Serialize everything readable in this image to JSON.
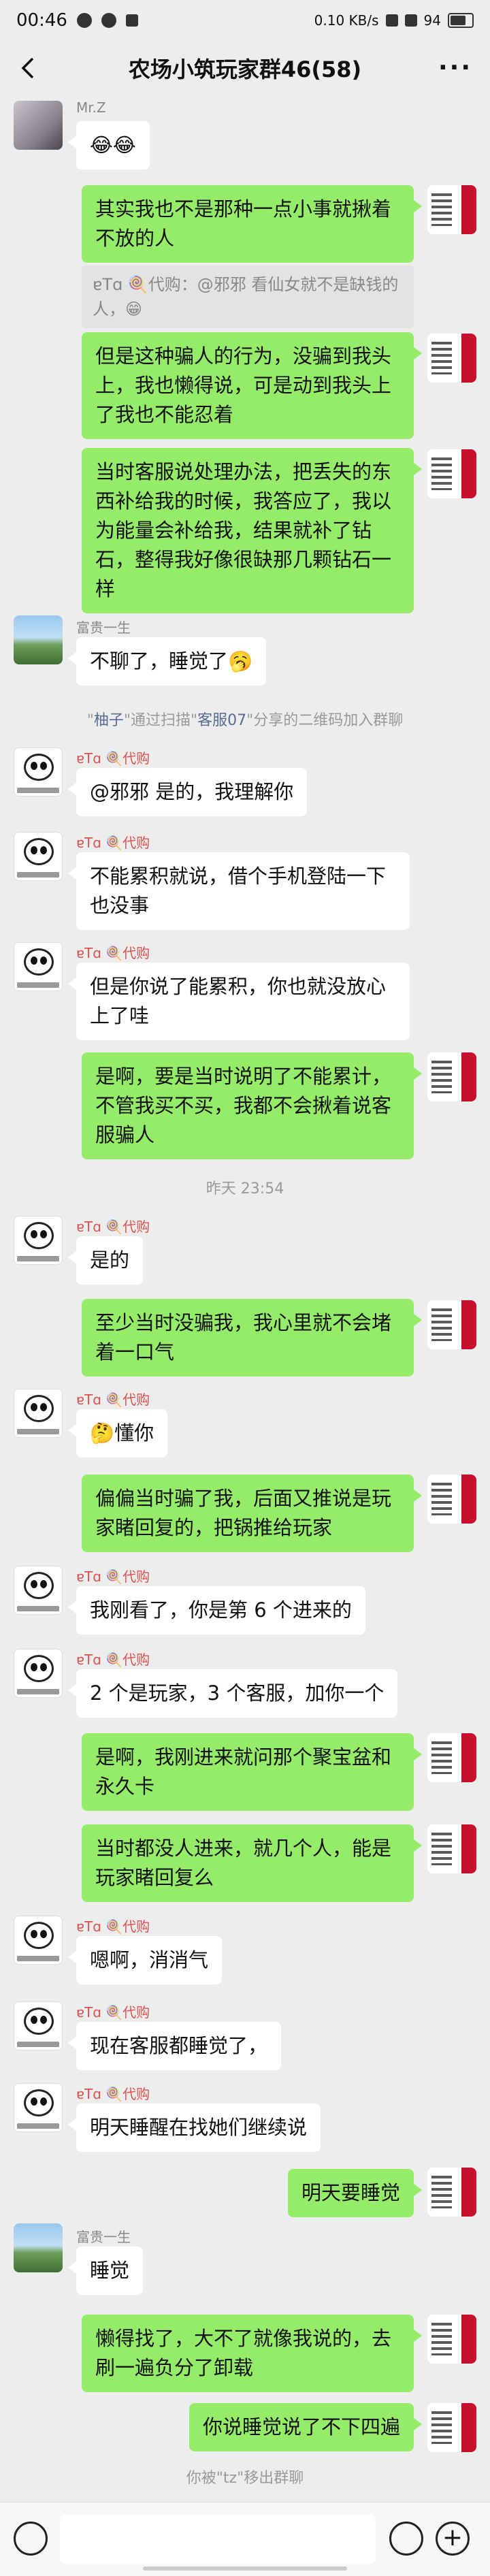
{
  "status": {
    "time": "00:46",
    "net_speed": "0.10 KB/s",
    "battery": "94"
  },
  "header": {
    "title": "农场小筑玩家群46(58)",
    "more": "···"
  },
  "messages": [
    {
      "id": "m1",
      "name": "Mr.Z",
      "text": "😂😂"
    },
    {
      "id": "m2",
      "text": "其实我也不是那种一点小事就揪着不放的人"
    },
    {
      "id": "q1",
      "text": "ɐTɑ 🍭代购：@邪邪 看仙女就不是缺钱的人，😁"
    },
    {
      "id": "m3",
      "text": "但是这种骗人的行为，没骗到我头上，我也懒得说，可是动到我头上了我也不能忍着"
    },
    {
      "id": "m4",
      "text": "当时客服说处理办法，把丢失的东西补给我的时候，我答应了，我以为能量会补给我，结果就补了钻石，整得我好像很缺那几颗钻石一样"
    },
    {
      "id": "m5",
      "name": "富贵一生",
      "text": "不聊了，睡觉了🥱"
    },
    {
      "id": "s1",
      "pre": "\"",
      "link1": "柚子",
      "mid": "\"通过扫描\"",
      "link2": "客服07",
      "post": "\"分享的二维码加入群聊"
    },
    {
      "id": "m6",
      "name": "ɐTɑ 🍭代购",
      "text": "@邪邪  是的，我理解你"
    },
    {
      "id": "m7",
      "name": "ɐTɑ 🍭代购",
      "text": "不能累积就说，借个手机登陆一下也没事"
    },
    {
      "id": "m8",
      "name": "ɐTɑ 🍭代购",
      "text": "但是你说了能累积，你也就没放心上了哇"
    },
    {
      "id": "m9",
      "text": "是啊，要是当时说明了不能累计，不管我买不买，我都不会揪着说客服骗人"
    },
    {
      "id": "s2",
      "text": "昨天 23:54"
    },
    {
      "id": "m10",
      "name": "ɐTɑ 🍭代购",
      "text": "是的"
    },
    {
      "id": "m11",
      "text": "至少当时没骗我，我心里就不会堵着一口气"
    },
    {
      "id": "m12",
      "name": "ɐTɑ 🍭代购",
      "text": "🤔懂你"
    },
    {
      "id": "m13",
      "text": "偏偏当时骗了我，后面又推说是玩家睹回复的，把锅推给玩家"
    },
    {
      "id": "m14",
      "name": "ɐTɑ 🍭代购",
      "text": "我刚看了，你是第 6 个进来的"
    },
    {
      "id": "m15",
      "name": "ɐTɑ 🍭代购",
      "text": "2 个是玩家，3 个客服，加你一个"
    },
    {
      "id": "m16",
      "text": "是啊，我刚进来就问那个聚宝盆和永久卡"
    },
    {
      "id": "m17",
      "text": "当时都没人进来，就几个人，能是玩家睹回复么"
    },
    {
      "id": "m18",
      "name": "ɐTɑ 🍭代购",
      "text": "嗯啊，消消气"
    },
    {
      "id": "m19",
      "name": "ɐTɑ 🍭代购",
      "text": "现在客服都睡觉了，"
    },
    {
      "id": "m20",
      "name": "ɐTɑ 🍭代购",
      "text": "明天睡醒在找她们继续说"
    },
    {
      "id": "m21",
      "text": "明天要睡觉"
    },
    {
      "id": "m22",
      "name": "富贵一生",
      "text": "睡觉"
    },
    {
      "id": "m23",
      "text": "懒得找了，大不了就像我说的，去刷一遍负分了卸载"
    },
    {
      "id": "m24",
      "text": "你说睡觉说了不下四遍"
    },
    {
      "id": "s3",
      "text": "你被\"tz\"移出群聊"
    }
  ]
}
